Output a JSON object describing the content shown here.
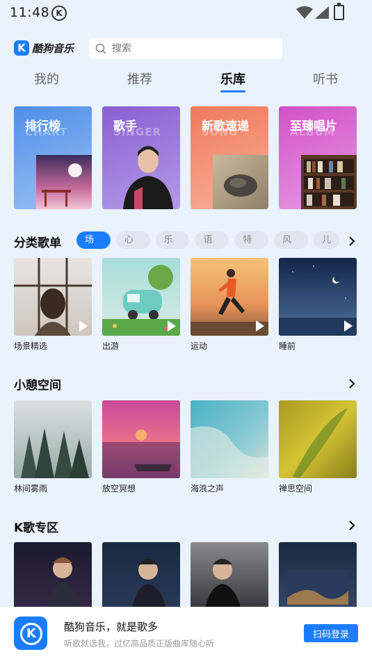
{
  "status": {
    "time": "11:48"
  },
  "app": {
    "logo_letter": "K",
    "logo_text": "酷狗音乐"
  },
  "search": {
    "placeholder": "搜索"
  },
  "tabs": [
    {
      "label": "我的"
    },
    {
      "label": "推荐"
    },
    {
      "label": "乐库"
    },
    {
      "label": "听书"
    }
  ],
  "banners": [
    {
      "title": "排行榜",
      "ghost": "CHART"
    },
    {
      "title": "歌手",
      "ghost": "SINGER"
    },
    {
      "title": "新歌速递",
      "ghost": "SONG"
    },
    {
      "title": "至臻唱片",
      "ghost": "ALBUM"
    }
  ],
  "categories": {
    "title": "分类歌单",
    "chips": [
      "场景",
      "心情",
      "乐器",
      "语言",
      "特色",
      "风格",
      "儿"
    ],
    "items": [
      {
        "label": "场景精选"
      },
      {
        "label": "出游"
      },
      {
        "label": "运动"
      },
      {
        "label": "睡前"
      }
    ]
  },
  "rest": {
    "title": "小憩空间",
    "items": [
      {
        "label": "林间雾雨"
      },
      {
        "label": "放空冥想"
      },
      {
        "label": "海浪之声"
      },
      {
        "label": "禅思空间"
      }
    ]
  },
  "ktv": {
    "title": "K歌专区"
  },
  "footer": {
    "title": "酷狗音乐，就是歌多",
    "subtitle": "听歌就选我，过亿高品质正版曲库随心听",
    "button": "扫码登录"
  }
}
